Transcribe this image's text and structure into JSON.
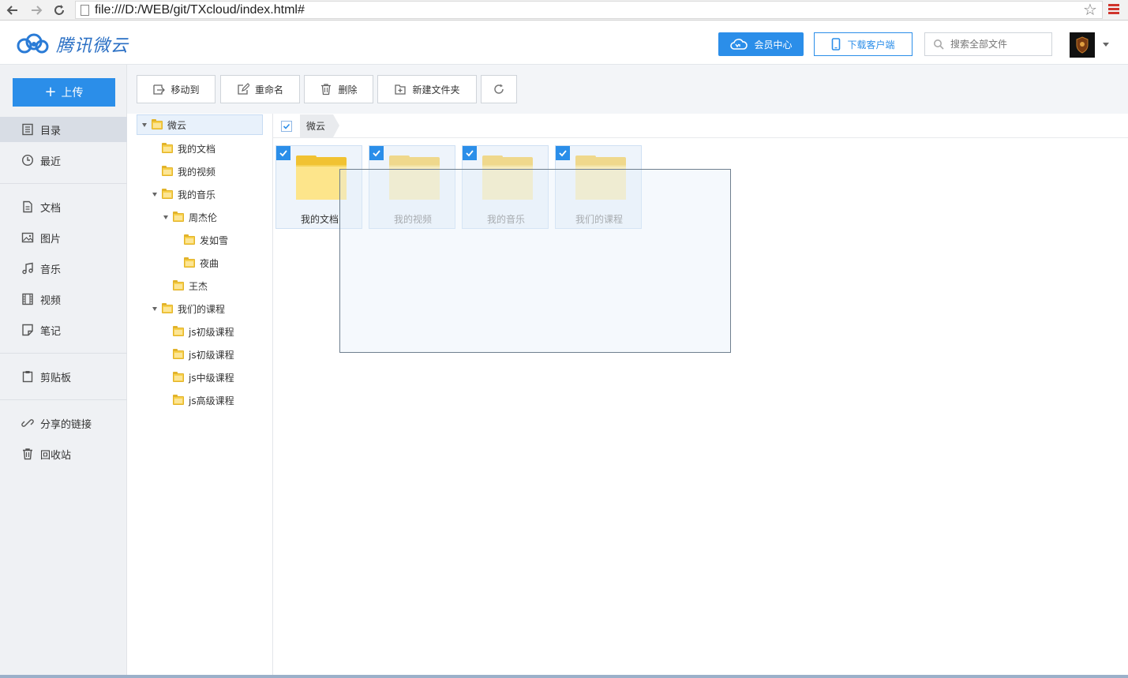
{
  "browser": {
    "url": "file:///D:/WEB/git/TXcloud/index.html#"
  },
  "header": {
    "logo_text": "腾讯微云",
    "vip_label": "会员中心",
    "download_label": "下载客户端",
    "search_placeholder": "搜索全部文件"
  },
  "leftnav": {
    "upload_label": "上传",
    "items": [
      {
        "label": "目录",
        "icon": "list-icon"
      },
      {
        "label": "最近",
        "icon": "clock-icon"
      },
      {
        "label": "文档",
        "icon": "document-icon"
      },
      {
        "label": "图片",
        "icon": "image-icon"
      },
      {
        "label": "音乐",
        "icon": "music-icon"
      },
      {
        "label": "视频",
        "icon": "film-icon"
      },
      {
        "label": "笔记",
        "icon": "note-icon"
      },
      {
        "label": "剪贴板",
        "icon": "clipboard-icon"
      },
      {
        "label": "分享的链接",
        "icon": "link-icon"
      },
      {
        "label": "回收站",
        "icon": "trash-icon"
      }
    ]
  },
  "toolbar": {
    "move_label": "移动到",
    "rename_label": "重命名",
    "delete_label": "删除",
    "new_folder_label": "新建文件夹"
  },
  "tree": {
    "nodes": [
      {
        "label": "微云"
      },
      {
        "label": "我的文档"
      },
      {
        "label": "我的视频"
      },
      {
        "label": "我的音乐"
      },
      {
        "label": "周杰伦"
      },
      {
        "label": "发如雪"
      },
      {
        "label": "夜曲"
      },
      {
        "label": "王杰"
      },
      {
        "label": "我们的课程"
      },
      {
        "label": "js初级课程"
      },
      {
        "label": "js初级课程"
      },
      {
        "label": "js中级课程"
      },
      {
        "label": "js高级课程"
      }
    ]
  },
  "main": {
    "breadcrumb": "微云",
    "files": [
      {
        "name": "我的文档"
      },
      {
        "name": "我的视频"
      },
      {
        "name": "我的音乐"
      },
      {
        "name": "我们的课程"
      }
    ]
  },
  "colors": {
    "accent": "#2b8ee9",
    "folder": "#f1c232"
  }
}
